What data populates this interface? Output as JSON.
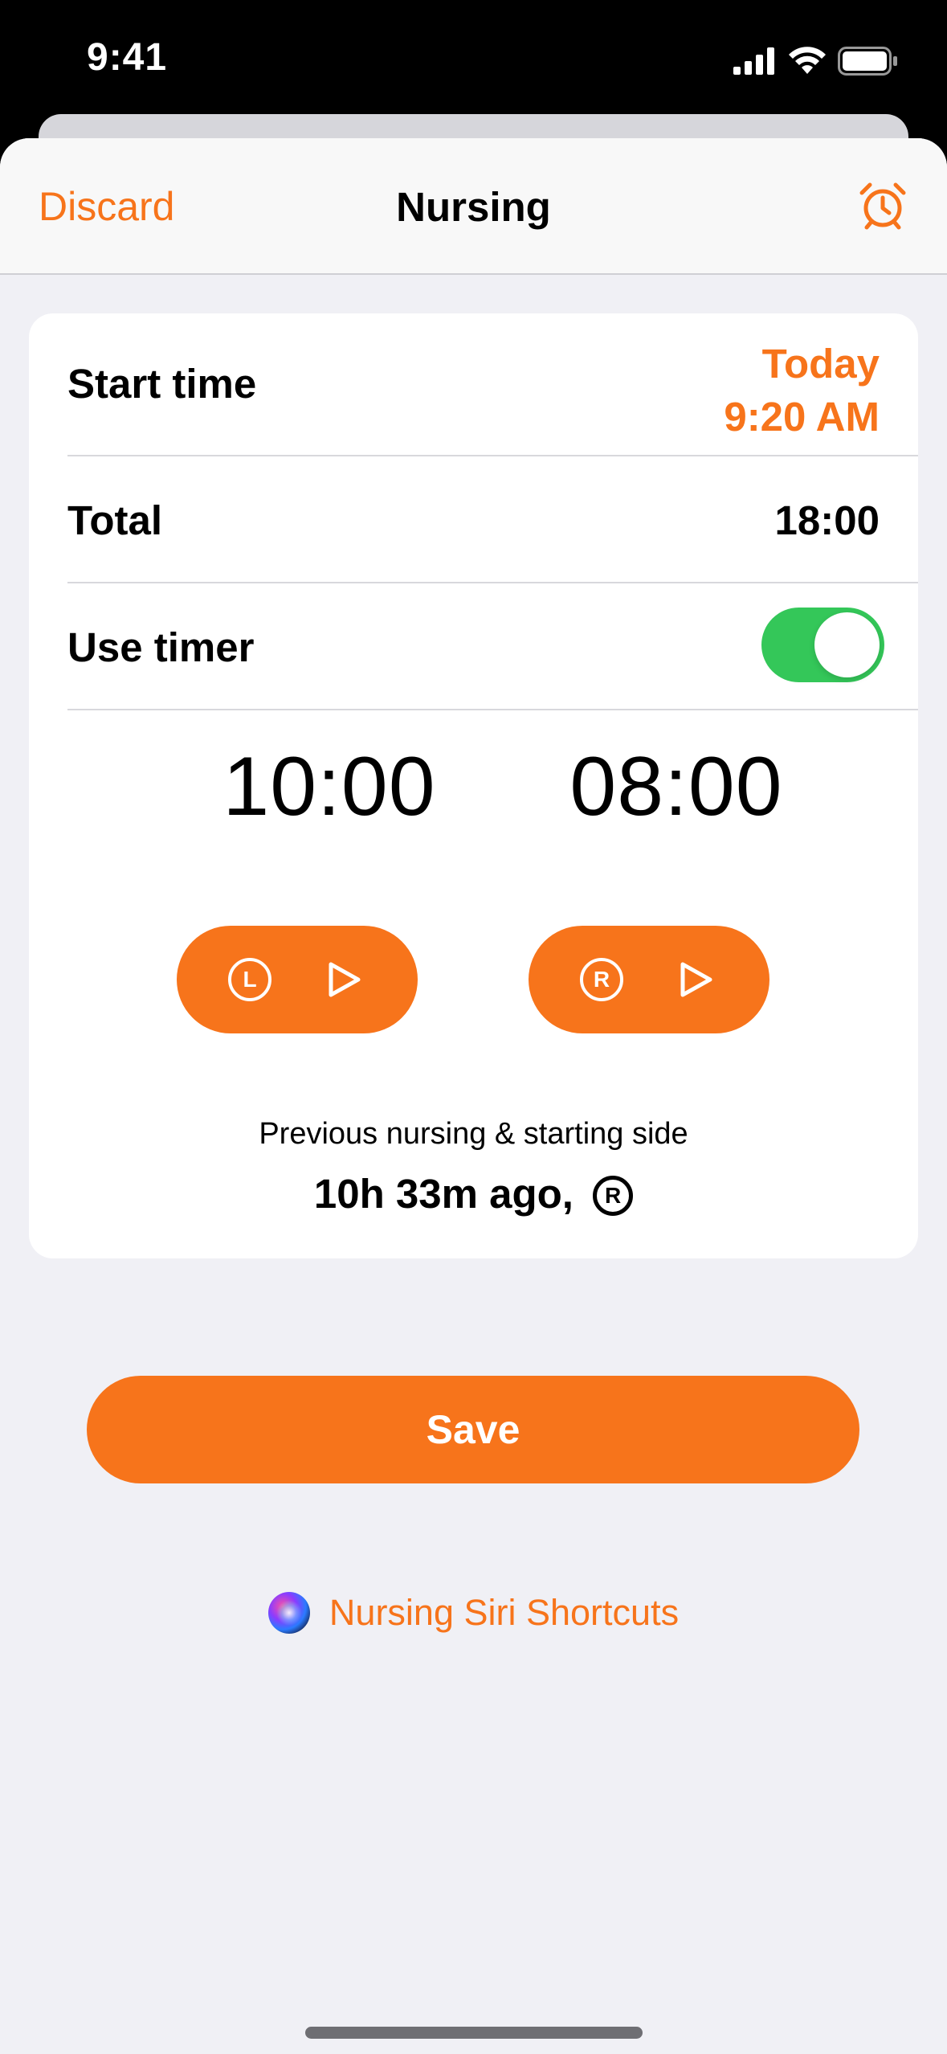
{
  "status_bar": {
    "time": "9:41",
    "icons": [
      "cellular-signal-icon",
      "wifi-icon",
      "battery-icon"
    ]
  },
  "nav": {
    "discard_label": "Discard",
    "title": "Nursing",
    "alarm_icon": "alarm-clock-icon"
  },
  "form": {
    "start_time": {
      "label": "Start time",
      "value_date": "Today",
      "value_time": "9:20 AM"
    },
    "total": {
      "label": "Total",
      "value": "18:00"
    },
    "use_timer": {
      "label": "Use timer",
      "on": true
    }
  },
  "timers": {
    "left": {
      "value": "10:00",
      "side_letter": "L",
      "icon": "play-icon"
    },
    "right": {
      "value": "08:00",
      "side_letter": "R",
      "icon": "play-icon"
    }
  },
  "previous": {
    "label": "Previous nursing & starting side",
    "value": "10h 33m ago,",
    "side_letter": "R"
  },
  "save_label": "Save",
  "siri": {
    "label": "Nursing Siri Shortcuts",
    "icon": "siri-icon"
  },
  "colors": {
    "accent": "#f7741b",
    "toggle_on": "#34c759",
    "background": "#f0f0f5"
  }
}
